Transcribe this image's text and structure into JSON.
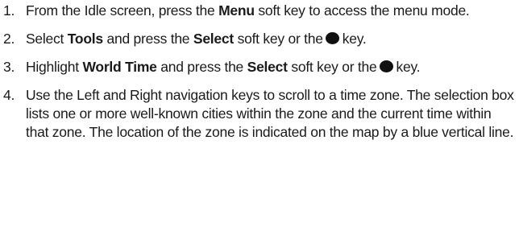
{
  "steps": [
    {
      "number": "1.",
      "parts": [
        {
          "t": "From the Idle screen, press the "
        },
        {
          "b": "Menu"
        },
        {
          "t": " soft key to access the menu mode."
        }
      ]
    },
    {
      "number": "2.",
      "parts": [
        {
          "t": "Select "
        },
        {
          "b": "Tools"
        },
        {
          "t": " and press the "
        },
        {
          "b": "Select"
        },
        {
          "t": " soft key or the"
        },
        {
          "icon": "center-key-icon"
        },
        {
          "t": "key."
        }
      ]
    },
    {
      "number": "3.",
      "parts": [
        {
          "t": "Highlight "
        },
        {
          "b": "World Time"
        },
        {
          "t": " and press the "
        },
        {
          "b": "Select"
        },
        {
          "t": " soft key or the"
        },
        {
          "icon": "center-key-icon"
        },
        {
          "t": "key."
        }
      ]
    },
    {
      "number": "4.",
      "parts": [
        {
          "t": "Use the Left and Right navigation keys to scroll to a time zone. The selection box lists one or more well-known cities within the zone and the current time within that zone. The location of the zone is indicated on the map by a blue vertical line."
        }
      ]
    }
  ]
}
